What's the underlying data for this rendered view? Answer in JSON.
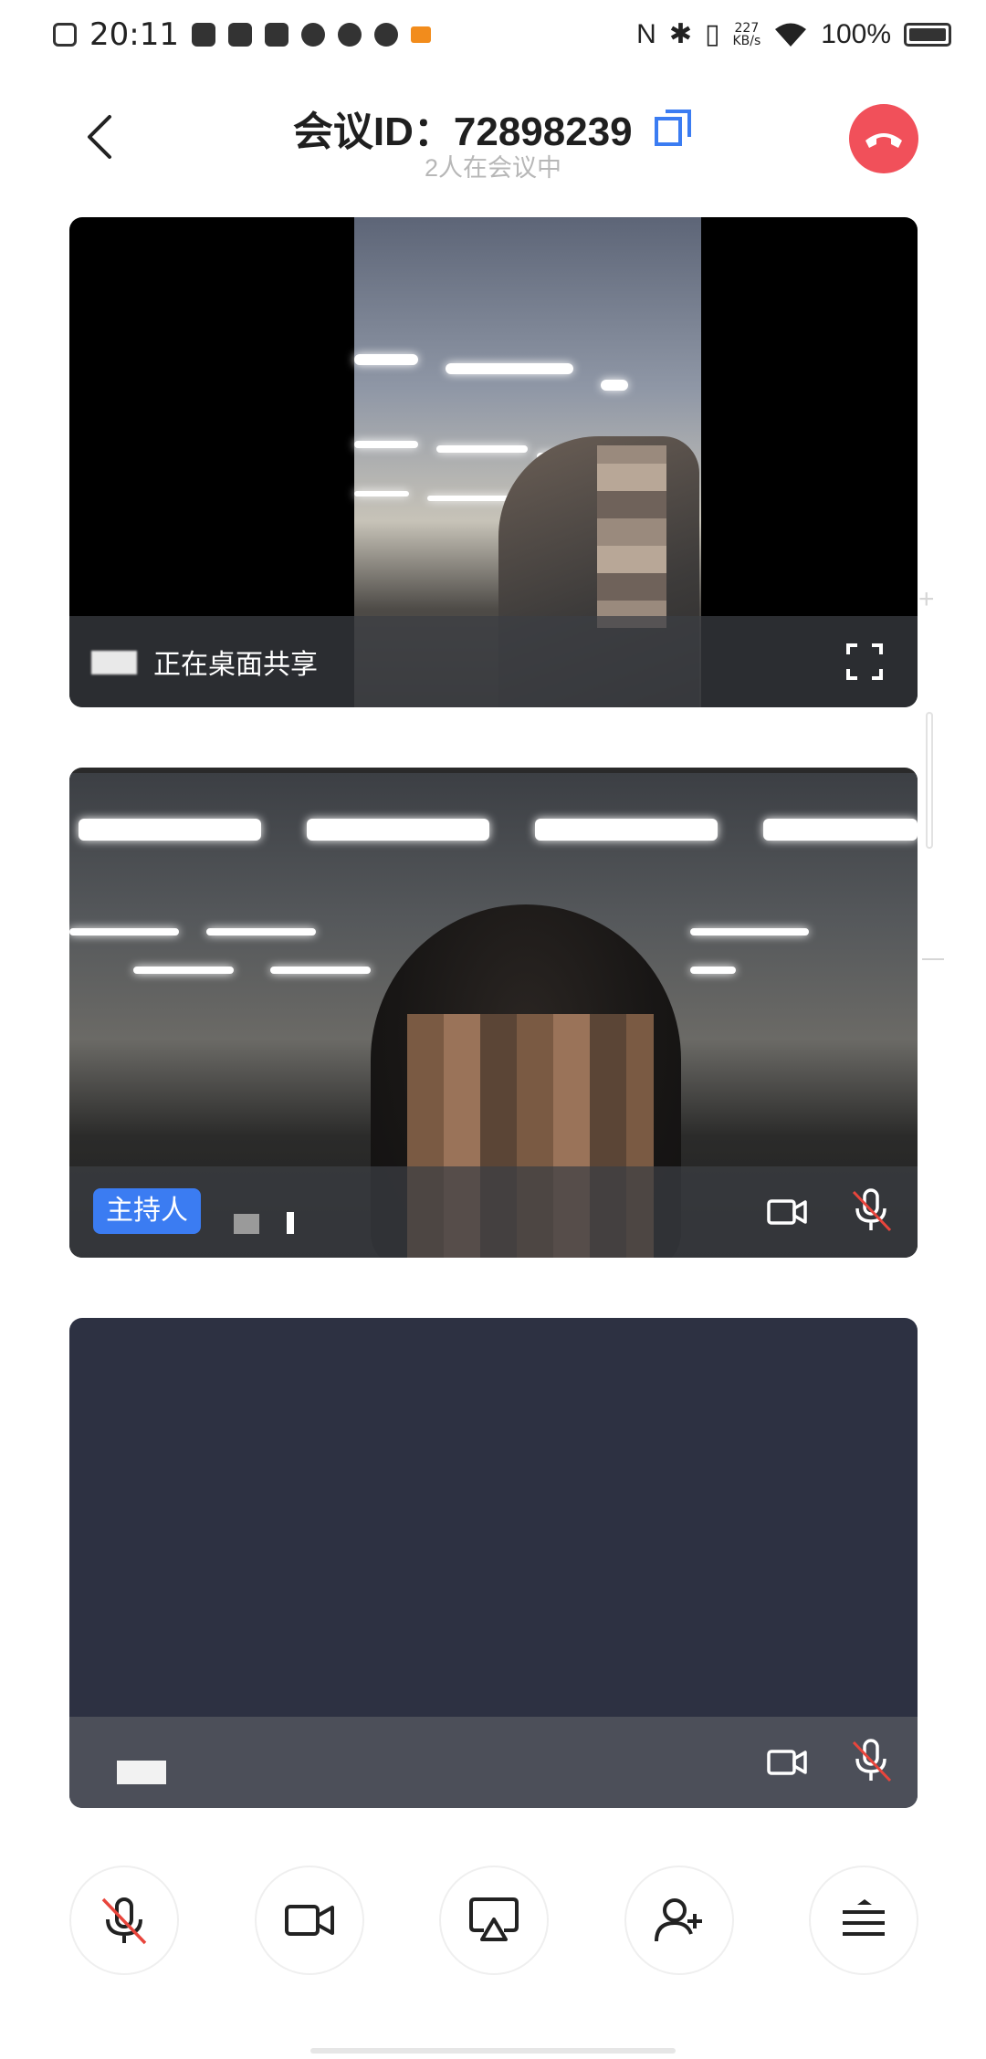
{
  "status_bar": {
    "time": "20:11",
    "net_speed_value": "227",
    "net_speed_unit": "KB/s",
    "battery": "100%"
  },
  "header": {
    "title": "会议ID：72898239",
    "subtitle": "2人在会议中",
    "back_icon": "chevron-left-icon",
    "copy_icon": "copy-icon",
    "hangup_icon": "hangup-phone-icon",
    "hangup_color": "#f1505a"
  },
  "tiles": [
    {
      "label": "正在桌面共享",
      "control_icon": "fullscreen-icon"
    },
    {
      "badge": "主持人",
      "badge_color": "#3b7cf2",
      "camera_icon": "video-camera-icon",
      "mic_icon": "mic-muted-icon"
    },
    {
      "camera_icon": "video-camera-icon",
      "mic_icon": "mic-muted-icon"
    }
  ],
  "toolbar": {
    "items": [
      {
        "icon": "mic-muted-icon"
      },
      {
        "icon": "video-camera-icon"
      },
      {
        "icon": "screen-share-icon"
      },
      {
        "icon": "add-person-icon"
      },
      {
        "icon": "menu-icon"
      }
    ]
  }
}
